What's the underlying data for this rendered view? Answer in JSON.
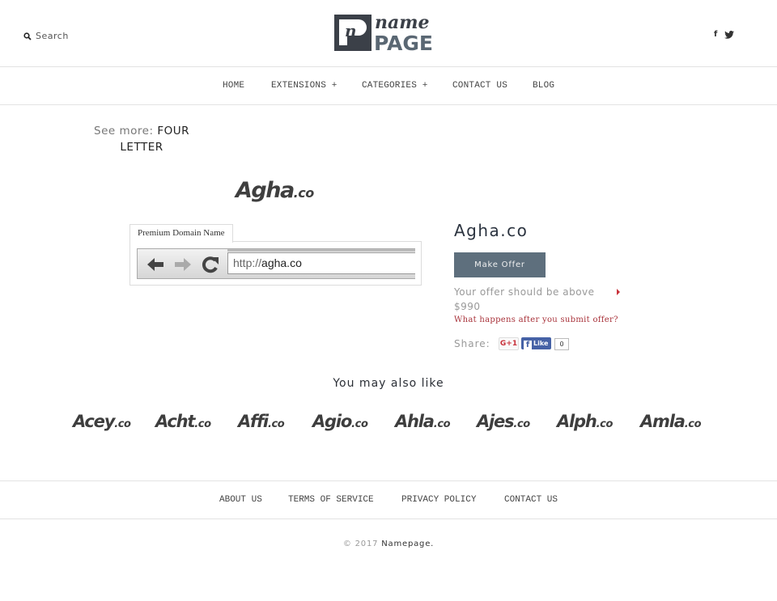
{
  "header": {
    "search_label": "Search",
    "logo_top": "name",
    "logo_bottom": "PAGE",
    "social": [
      "f",
      "twitter"
    ]
  },
  "nav": {
    "items": [
      {
        "label": "HOME"
      },
      {
        "label": "EXTENSIONS +"
      },
      {
        "label": "CATEGORIES +"
      },
      {
        "label": "CONTACT US"
      },
      {
        "label": "BLOG"
      }
    ]
  },
  "see_more": {
    "label": "See more:",
    "link": "FOUR LETTER"
  },
  "domain": {
    "logo_name": "Agha",
    "logo_tld": ".co",
    "tab_label": "Premium Domain Name",
    "url_prefix": "http://",
    "url_domain": "agha.co",
    "title": "Agha.co",
    "make_offer_label": "Make Offer",
    "offer_text": "Your offer should be above $990",
    "what_happens_link": "What happens after you submit offer?",
    "share_label": "Share:",
    "gplus_label": "G+1",
    "fb_like_label": "Like",
    "fb_count": "0"
  },
  "related": {
    "title": "You may also like",
    "items": [
      {
        "name": "Acey",
        "tld": ".co"
      },
      {
        "name": "Acht",
        "tld": ".co"
      },
      {
        "name": "Affi",
        "tld": ".co"
      },
      {
        "name": "Agio",
        "tld": ".co"
      },
      {
        "name": "Ahla",
        "tld": ".co"
      },
      {
        "name": "Ajes",
        "tld": ".co"
      },
      {
        "name": "Alph",
        "tld": ".co"
      },
      {
        "name": "Amla",
        "tld": ".co"
      }
    ]
  },
  "footer": {
    "items": [
      {
        "label": "ABOUT US"
      },
      {
        "label": "TERMS OF SERVICE"
      },
      {
        "label": "PRIVACY POLICY"
      },
      {
        "label": "CONTACT US"
      }
    ],
    "copyright": "© 2017",
    "brand": "Namepage."
  },
  "colors": {
    "button_bg": "#5e6f7d",
    "accent_red": "#a8323a",
    "facebook_blue": "#4662a6"
  }
}
